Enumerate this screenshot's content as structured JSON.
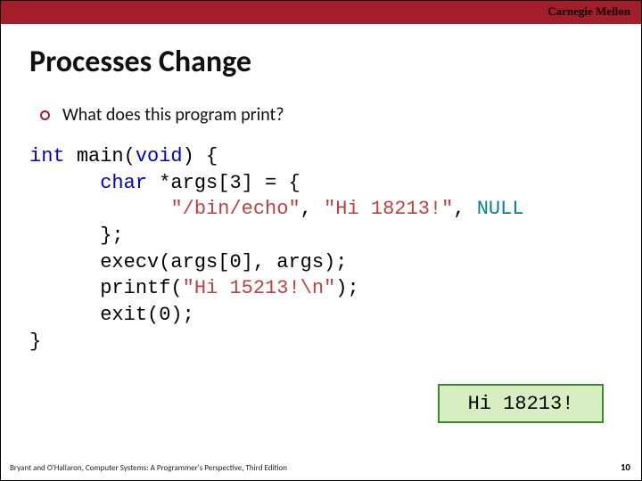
{
  "header": {
    "institution": "Carnegie Mellon"
  },
  "title": "Processes Change",
  "bullet": "What does this program print?",
  "code": {
    "kw_int": "int",
    "fn_main": "main",
    "kw_void": "void",
    "brace_open": " {",
    "kw_char": "char",
    "args_decl": " *args[3] = {",
    "str_path": "\"/bin/echo\"",
    "comma1": ", ",
    "str_hi": "\"Hi 18213!\"",
    "comma2": ", ",
    "kw_null": "NULL",
    "close_init": "};",
    "execv_call": "execv(args[0], args);",
    "printf_call_open": "printf(",
    "printf_str": "\"Hi 15213!\\n\"",
    "printf_call_close": ");",
    "exit_call": "exit(0);",
    "brace_close": "}"
  },
  "answer": "Hi 18213!",
  "footer": {
    "citation": "Bryant and O'Hallaron, Computer Systems: A Programmer's Perspective, Third Edition",
    "page": "10"
  }
}
